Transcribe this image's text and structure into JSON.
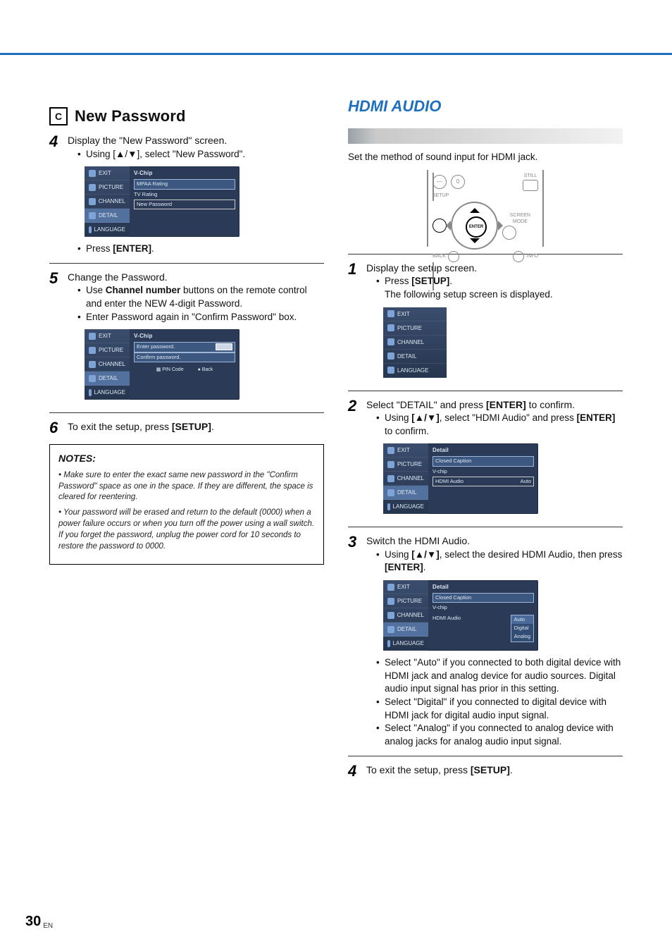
{
  "page_number": "30",
  "page_suffix": "EN",
  "left": {
    "section_letter": "C",
    "section_title": "New Password",
    "step4": {
      "num": "4",
      "title": "Display the \"New Password\" screen.",
      "b1": "Using [▲/▼], select \"New Password\".",
      "b2": "Press [ENTER]."
    },
    "step5": {
      "num": "5",
      "title": "Change the Password.",
      "b1": "Use Channel number buttons on the remote control and enter the NEW 4-digit Password.",
      "b2": "Enter Password again in \"Confirm Password\" box."
    },
    "step6": {
      "num": "6",
      "title": "To exit the setup, press [SETUP]."
    },
    "notes": {
      "heading": "NOTES:",
      "n1": "Make sure to enter the exact same new password in the \"Confirm Password\" space as one in the space. If they are different, the space is cleared for reentering.",
      "n2": "Your password will be erased and return to the default (0000) when a power failure occurs or when you turn off the power using a wall switch. If you forget the password, unplug the power cord for 10 seconds to restore the password to 0000."
    },
    "osd1": {
      "title": "V-Chip",
      "items": [
        "EXIT",
        "PICTURE",
        "CHANNEL",
        "DETAIL",
        "LANGUAGE"
      ],
      "rows": [
        "MPAA Rating",
        "TV Rating",
        "New Password"
      ]
    },
    "osd2": {
      "title": "V-Chip",
      "items": [
        "EXIT",
        "PICTURE",
        "CHANNEL",
        "DETAIL",
        "LANGUAGE"
      ],
      "enter_label": "Enter password.",
      "confirm_label": "Confirm password.",
      "pin_label": "PIN Code",
      "back_label": "Back"
    }
  },
  "right": {
    "section_title": "HDMI AUDIO",
    "intro": "Set the method of sound input for HDMI jack.",
    "remote": {
      "still": "STILL",
      "screen_mode": "SCREEN MODE",
      "setup": "SETUP",
      "enter": "ENTER",
      "back": "BACK",
      "info": "INFO",
      "minus": "—",
      "zero": "0"
    },
    "step1": {
      "num": "1",
      "title": "Display the setup screen.",
      "b1": "Press [SETUP].",
      "b1_sub": "The following setup screen is displayed."
    },
    "step2": {
      "num": "2",
      "title": "Select \"DETAIL\" and press [ENTER] to confirm.",
      "b1": "Using [▲/▼], select \"HDMI Audio\" and press [ENTER] to confirm."
    },
    "step3": {
      "num": "3",
      "title": "Switch the HDMI Audio.",
      "b1": "Using [▲/▼], select the desired HDMI Audio, then press [ENTER].",
      "b_auto": "Select \"Auto\" if you connected to both digital device with HDMI jack and analog device for audio sources. Digital audio input signal has prior in this setting.",
      "b_digital": "Select \"Digital\" if you connected to digital device with HDMI jack for digital audio input signal.",
      "b_analog": "Select \"Analog\" if you connected to analog device with analog jacks for analog audio input signal."
    },
    "step4": {
      "num": "4",
      "title": "To exit the setup, press [SETUP]."
    },
    "osd_menu": {
      "items": [
        "EXIT",
        "PICTURE",
        "CHANNEL",
        "DETAIL",
        "LANGUAGE"
      ]
    },
    "osd_detail": {
      "title": "Detail",
      "rows": [
        "Closed Caption",
        "V-chip",
        "HDMI Audio"
      ],
      "value": "Auto",
      "options": [
        "Auto",
        "Digital",
        "Analog"
      ]
    }
  }
}
